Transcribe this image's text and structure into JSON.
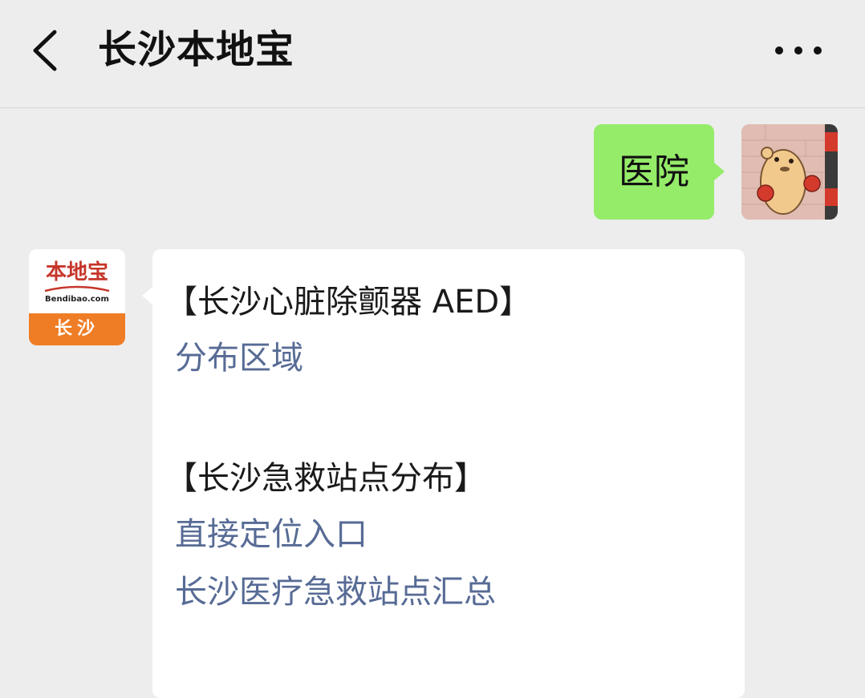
{
  "header": {
    "back_icon": "chevron-left-icon",
    "title": "长沙本地宝",
    "more_icon": "more-horizontal-icon"
  },
  "messages": [
    {
      "direction": "outgoing",
      "text": "医院",
      "avatar": "user-avatar"
    },
    {
      "direction": "incoming",
      "avatar": {
        "logo_text": "本地宝",
        "logo_url": "Bendibao.com",
        "logo_city": "长沙"
      },
      "section1_title": "【长沙心脏除颤器 AED】",
      "section1_link": "分布区域",
      "section2_title": "【长沙急救站点分布】",
      "section2_link1": "直接定位入口",
      "section2_link2": "长沙医疗急救站点汇总"
    }
  ],
  "colors": {
    "background": "#ededed",
    "outgoing_bubble": "#95ec69",
    "incoming_bubble": "#ffffff",
    "link": "#576b95",
    "logo_red": "#c6362a",
    "logo_orange": "#ef7d25"
  }
}
